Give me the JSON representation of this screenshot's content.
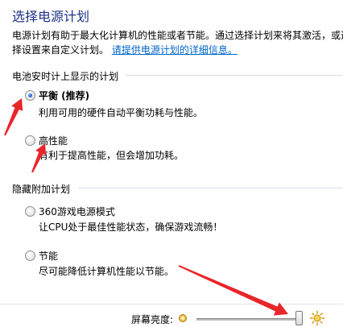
{
  "title": "选择电源计划",
  "description": {
    "line1": "电源计划有助于最大化计算机的性能或者节能。通过选择计划来将其激活，或选",
    "line2_prefix": "择设置来自定义计划。",
    "link": "请提供电源计划的详细信息。"
  },
  "battery_group": {
    "label": "电池安时计上显示的计划",
    "options": [
      {
        "title": "平衡 (推荐)",
        "desc": "利用可用的硬件自动平衡功耗与性能。",
        "checked": true
      },
      {
        "title": "高性能",
        "desc": "有利于提高性能，但会增加功耗。",
        "checked": false
      }
    ]
  },
  "hidden_group": {
    "label": "隐藏附加计划",
    "options": [
      {
        "title": "360游戏电源模式",
        "desc": "让CPU处于最佳性能状态，确保游戏流畅！",
        "checked": false
      },
      {
        "title": "节能",
        "desc": "尽可能降低计算机性能以节能。",
        "checked": false
      }
    ]
  },
  "brightness": {
    "label": "屏幕亮度:",
    "level_percent": 100
  },
  "colors": {
    "title": "#1e3287",
    "link": "#0066cc",
    "annotation_arrow": "#e8262a"
  },
  "icons": {
    "dim": "dim-sun-icon",
    "bright": "bright-sun-icon"
  }
}
